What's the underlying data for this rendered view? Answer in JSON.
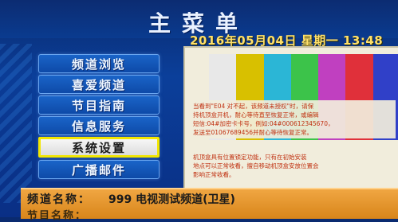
{
  "header": {
    "title": "主菜单",
    "datetime": "2016年05月04日  星期一   13:48"
  },
  "menu": {
    "items": [
      {
        "label": "频道浏览",
        "active": false
      },
      {
        "label": "喜爱频道",
        "active": false
      },
      {
        "label": "节目指南",
        "active": false
      },
      {
        "label": "信息服务",
        "active": false
      },
      {
        "label": "系统设置",
        "active": true
      },
      {
        "label": "广播邮件",
        "active": false
      }
    ]
  },
  "preview": {
    "bar_colors": [
      "#e8e8e8",
      "#d8c000",
      "#2bb6d6",
      "#3cc34a",
      "#c040c0",
      "#e0303a",
      "#3040c8"
    ],
    "message_lines": [
      "当看到\"E04 对不起，该频道未授权\"时，请保",
      "持机顶盒开机，耐心等待直至恢复正常，或编辑",
      "短信:04#加密卡卡号，例如:04#000612345670，",
      "发送至01067689456并耐心等待恢复正常。"
    ],
    "message2_lines": [
      "机顶盒具有位置锁定功能，只有在初始安装",
      "地点可以正常收看，擅自移动机顶盒安放位置会",
      "影响正常收看。"
    ]
  },
  "info": {
    "channel_label": "频道名称：",
    "channel_value": "999 电视测试频道(卫星)",
    "program_label": "节目名称："
  },
  "colors": {
    "background": "#0b3f9a",
    "highlight_border": "#f2e600",
    "info_bar": "#e8952e"
  }
}
